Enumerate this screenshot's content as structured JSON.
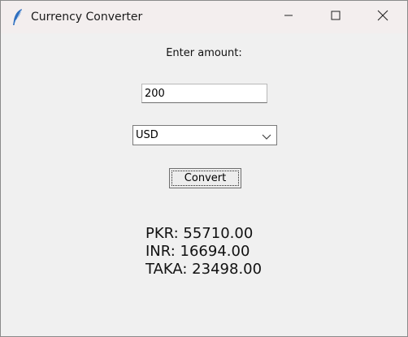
{
  "window": {
    "title": "Currency Converter",
    "icon": "feather-icon",
    "controls": [
      "minimize-icon",
      "maximize-icon",
      "close-icon"
    ]
  },
  "form": {
    "amount_label": "Enter amount:",
    "amount_value": "200",
    "currency_selected": "USD",
    "convert_label": "Convert"
  },
  "results": [
    "PKR: 55710.00",
    "INR: 16694.00",
    "TAKA: 23498.00"
  ],
  "colors": {
    "window_bg": "#f0f0f0",
    "titlebar_bg": "#f3eeee",
    "icon_blue": "#2f6fbf"
  }
}
